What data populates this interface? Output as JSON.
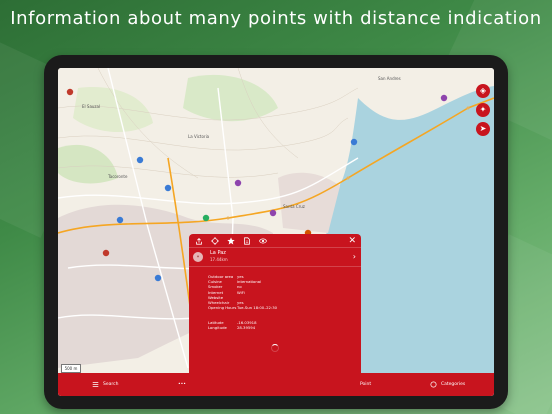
{
  "headline": "Information about many points with distance indication",
  "colors": {
    "accent": "#c8141e",
    "background": "#3f8a47",
    "map_sea": "#aad3df",
    "map_land": "#f3efe6"
  },
  "map": {
    "scale_label": "500 m",
    "place_labels": [
      "El Sauzal",
      "La Victoria",
      "Tacoronte",
      "La Laguna",
      "San Andres",
      "Santa Cruz"
    ],
    "controls": [
      {
        "name": "layers-icon",
        "glyph": "◈"
      },
      {
        "name": "compass-icon",
        "glyph": "✦"
      },
      {
        "name": "locate-icon",
        "glyph": "➤"
      }
    ]
  },
  "panel": {
    "toolbar_icons": [
      "share-icon",
      "crosshair-icon",
      "star-icon",
      "document-icon",
      "eye-icon"
    ],
    "close_glyph": "✕",
    "poi": {
      "name": "La Paz",
      "distance": "17.44km",
      "icon_glyph": "⑂"
    },
    "attributes": [
      {
        "key": "Outdoor area",
        "value": "yes"
      },
      {
        "key": "Cuisine",
        "value": "international"
      },
      {
        "key": "Smoker",
        "value": "no"
      },
      {
        "key": "Internet",
        "value": "WiFi"
      },
      {
        "key": "Website",
        "value": ""
      },
      {
        "key": "Wheelchair",
        "value": "yes"
      },
      {
        "key": "Opening Hours",
        "value": "Tue-Sun 18:00–22:30"
      }
    ],
    "coordinates": [
      {
        "key": "Latitude",
        "value": "-16.03918"
      },
      {
        "key": "Longitude",
        "value": "28.39594"
      }
    ]
  },
  "bottom_bar": {
    "search_label": "Search",
    "more_label": "•••",
    "point_label": "Point",
    "categories_label": "Categories"
  }
}
